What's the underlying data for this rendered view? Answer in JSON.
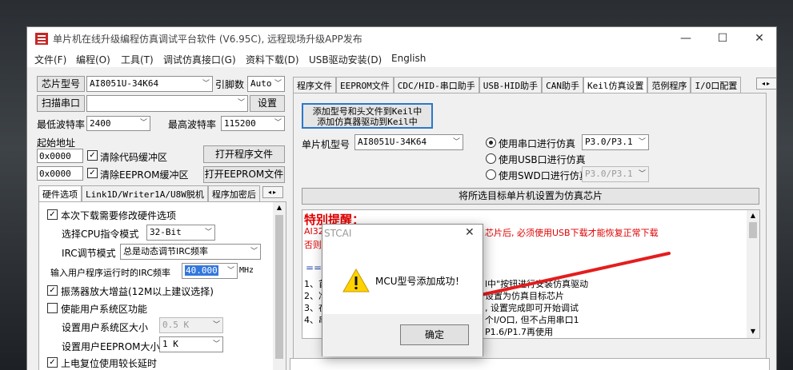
{
  "window": {
    "title": "单片机在线升级编程仿真调试平台软件 (V6.95C), 远程现场升级APP发布",
    "min": "—",
    "max": "☐",
    "close": "✕"
  },
  "menu": [
    "文件(F)",
    "编程(O)",
    "工具(T)",
    "调试仿真接口(G)",
    "资料下载(D)",
    "USB驱动安装(D)",
    "English"
  ],
  "left": {
    "chip_label": "芯片型号",
    "chip_value": "AI8051U-34K64",
    "pin_label": "引脚数",
    "pin_value": "Auto",
    "scan_label": "扫描串口",
    "port_value": "",
    "settings_label": "设置",
    "min_baud_label": "最低波特率",
    "min_baud": "2400",
    "max_baud_label": "最高波特率",
    "max_baud": "115200",
    "start_addr_label": "起始地址",
    "addr1": "0x0000",
    "addr2": "0x0000",
    "clear_code_label": "清除代码缓冲区",
    "clear_eeprom_label": "清除EEPROM缓冲区",
    "open_prog_label": "打开程序文件",
    "open_eeprom_label": "打开EEPROM文件",
    "tabs": [
      "硬件选项",
      "Link1D/Writer1A/U8W脱机",
      "程序加密后"
    ],
    "opts": {
      "modify_hw": "本次下载需要修改硬件选项",
      "cpu_mode_label": "选择CPU指令模式",
      "cpu_mode": "32-Bit",
      "irc_label": "IRC调节模式",
      "irc_mode": "总是动态调节IRC频率",
      "freq_label": "输入用户程序运行时的IRC频率",
      "freq": "40.000",
      "freq_unit": "MHz",
      "osc_gain": "振荡器放大增益(12M以上建议选择)",
      "sys_area": "使能用户系统区功能",
      "sys_size_label": "设置用户系统区大小",
      "sys_size": "0.5 K",
      "eeprom_size_label": "设置用户EEPROM大小",
      "eeprom_size": "1  K",
      "reset_delay": "上电复位使用较长延时"
    }
  },
  "right": {
    "tabs": [
      "程序文件",
      "EEPROM文件",
      "CDC/HID-串口助手",
      "USB-HID助手",
      "CAN助手",
      "Keil仿真设置",
      "范例程序",
      "I/O口配置"
    ],
    "keil_btn_line1": "添加型号和头文件到Keil中",
    "keil_btn_line2": "添加仿真器驱动到Keil中",
    "mcu_label": "单片机型号",
    "mcu_value": "AI8051U-34K64",
    "radio_serial": "使用串口进行仿真",
    "serial_port": "P3.0/P3.1",
    "radio_usb": "使用USB口进行仿真",
    "radio_swd": "使用SWD口进行仿真",
    "swd_port": "P3.0/P3.1",
    "set_target_label": "将所选目标单片机设置为仿真芯片",
    "reminder_title": "特别提醒：",
    "red_line1_left": "AI32",
    "red_line1_right": "芯片后, 必须使用USB下载才能恢复正常下载",
    "red_line2": "否则",
    "arrow": "==",
    "steps": [
      {
        "n": "1、首",
        "t": "l中\"按钮进行安装仿真驱动"
      },
      {
        "n": "2、准",
        "t": "设置为仿真目标芯片"
      },
      {
        "n": "3、在",
        "t": ", 设置完成即可开始调试"
      },
      {
        "n": "4、串",
        "t": "个I/O口, 但不占用串口1"
      },
      {
        "n": "",
        "t": "P1.6/P1.7再使用"
      }
    ]
  },
  "dialog": {
    "title": "STCAI",
    "message": "MCU型号添加成功！",
    "ok": "确定"
  }
}
